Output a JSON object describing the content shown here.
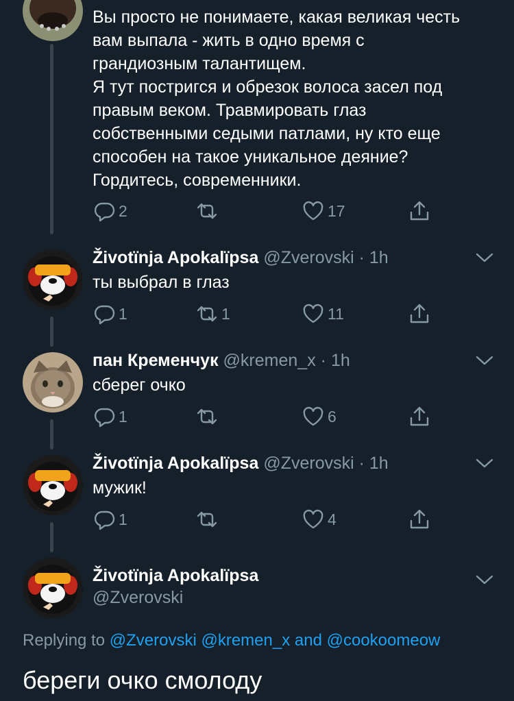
{
  "tweets": [
    {
      "text": "Вы просто не понимаете, какая великая честь\nвам выпала - жить в одно время с\nграндиозным талантищем.\nЯ тут постригся и обрезок волоса засел под\nправым веком. Травмировать глаз\nсобственными седыми патлами, ну кто еще\nспособен на такое уникальное деяние?\nГордитесь, современники.",
      "replies": "2",
      "retweets": "",
      "likes": "17"
    },
    {
      "name": "Životїnja Apokalїpsa",
      "handle": "@Zverovski",
      "time": "1h",
      "text": "ты выбрал в глаз",
      "replies": "1",
      "retweets": "1",
      "likes": "11"
    },
    {
      "name": "пан Кременчук",
      "handle": "@kremen_x",
      "time": "1h",
      "text": "сберег очко",
      "replies": "1",
      "retweets": "",
      "likes": "6"
    },
    {
      "name": "Životїnja Apokalїpsa",
      "handle": "@Zverovski",
      "time": "1h",
      "text": "мужик!",
      "replies": "1",
      "retweets": "",
      "likes": "4"
    }
  ],
  "main_tweet": {
    "name": "Životїnja Apokalїpsa",
    "handle": "@Zverovski",
    "replying_prefix": "Replying to",
    "mention_1": "@Zverovski",
    "mention_2": "@kremen_x",
    "and_word": "and",
    "mention_3": "@cookoomeow",
    "text": "береги очко смолоду"
  },
  "dot": "·",
  "colors": {
    "background": "#15202b",
    "muted": "#8899a6",
    "link": "#1da1f2",
    "thread_line": "#38444d"
  },
  "icons": [
    "reply-icon",
    "retweet-icon",
    "like-icon",
    "share-icon",
    "chevron-down-icon"
  ]
}
